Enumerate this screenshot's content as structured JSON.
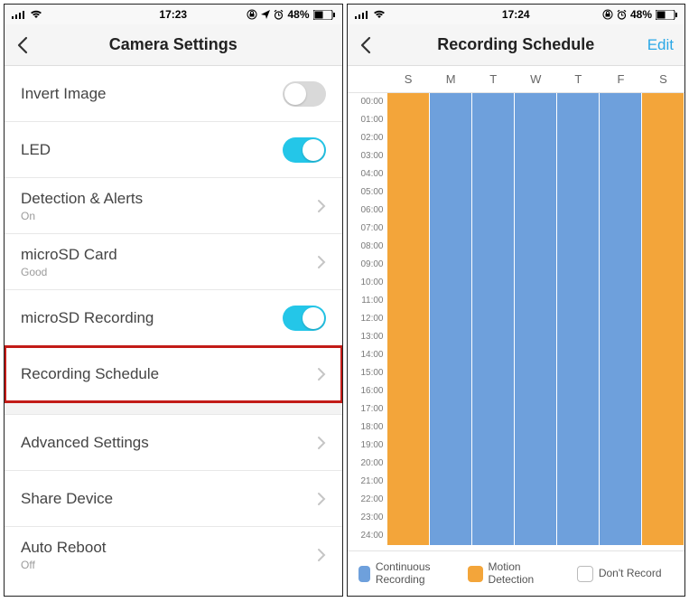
{
  "left": {
    "status": {
      "time": "17:23",
      "battery": "48%"
    },
    "title": "Camera Settings",
    "rows": {
      "invert": {
        "label": "Invert Image",
        "toggle": false
      },
      "led": {
        "label": "LED",
        "toggle": true
      },
      "detect": {
        "label": "Detection & Alerts",
        "sub": "On"
      },
      "sdcard": {
        "label": "microSD Card",
        "sub": "Good"
      },
      "sdrec": {
        "label": "microSD Recording",
        "toggle": true
      },
      "sched": {
        "label": "Recording Schedule"
      },
      "adv": {
        "label": "Advanced Settings"
      },
      "share": {
        "label": "Share Device"
      },
      "reboot": {
        "label": "Auto Reboot",
        "sub": "Off"
      }
    }
  },
  "right": {
    "status": {
      "time": "17:24",
      "battery": "48%"
    },
    "title": "Recording Schedule",
    "action": "Edit",
    "days": [
      "S",
      "M",
      "T",
      "W",
      "T",
      "F",
      "S"
    ],
    "hours": [
      "00:00",
      "01:00",
      "02:00",
      "03:00",
      "04:00",
      "05:00",
      "06:00",
      "07:00",
      "08:00",
      "09:00",
      "10:00",
      "11:00",
      "12:00",
      "13:00",
      "14:00",
      "15:00",
      "16:00",
      "17:00",
      "18:00",
      "19:00",
      "20:00",
      "21:00",
      "22:00",
      "23:00",
      "24:00"
    ],
    "schedule_by_day": [
      "motion",
      "continuous",
      "continuous",
      "continuous",
      "continuous",
      "continuous",
      "motion"
    ],
    "legend": {
      "cont": "Continuous Recording",
      "motion": "Motion Detection",
      "none": "Don't Record"
    }
  },
  "chart_data": {
    "type": "heatmap",
    "title": "Recording Schedule",
    "x_categories": [
      "S",
      "M",
      "T",
      "W",
      "T",
      "F",
      "S"
    ],
    "y_categories": [
      "00:00",
      "01:00",
      "02:00",
      "03:00",
      "04:00",
      "05:00",
      "06:00",
      "07:00",
      "08:00",
      "09:00",
      "10:00",
      "11:00",
      "12:00",
      "13:00",
      "14:00",
      "15:00",
      "16:00",
      "17:00",
      "18:00",
      "19:00",
      "20:00",
      "21:00",
      "22:00",
      "23:00"
    ],
    "legend": {
      "continuous": "Continuous Recording",
      "motion": "Motion Detection",
      "none": "Don't Record"
    },
    "column_mode": [
      "motion",
      "continuous",
      "continuous",
      "continuous",
      "continuous",
      "continuous",
      "motion"
    ],
    "note": "Every hour of a given day shares the same mode (whole-day coloring)."
  }
}
